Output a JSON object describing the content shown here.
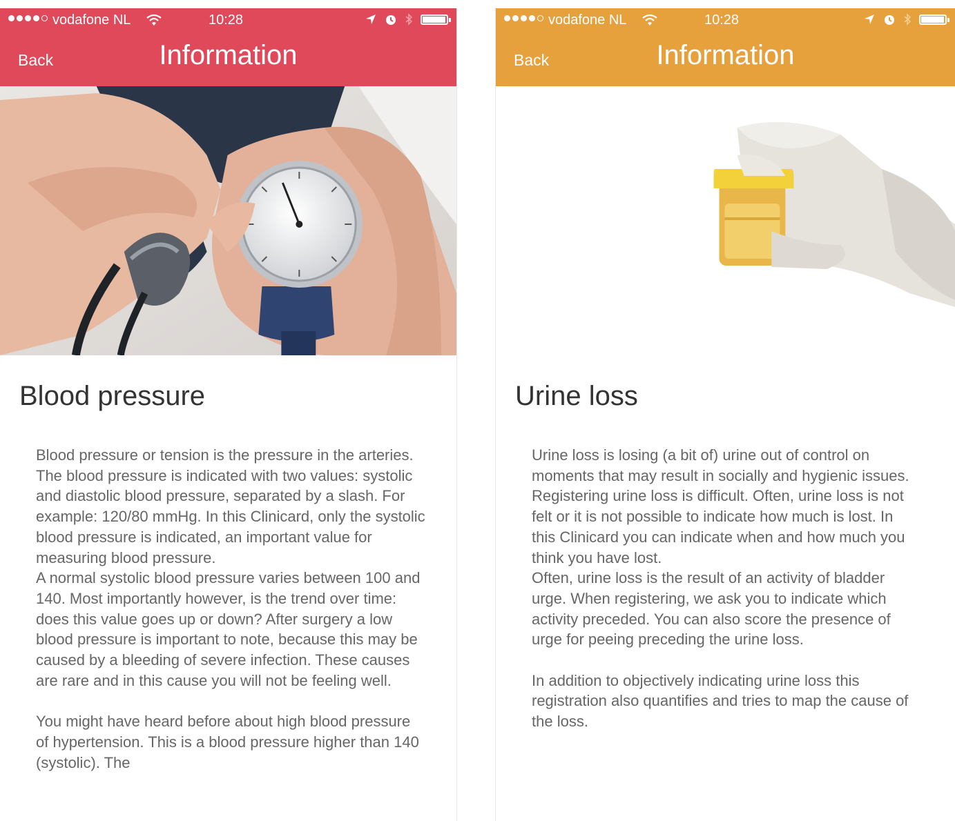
{
  "screens": [
    {
      "status": {
        "carrier": "vodafone NL",
        "time": "10:28"
      },
      "nav": {
        "back_label": "Back",
        "title": "Information",
        "color": "#e0495a"
      },
      "heading": "Blood pressure",
      "paragraphs": [
        "Blood pressure or tension is the pressure in the arteries. The blood pressure is indicated with two values: systolic and diastolic blood pressure, separated by a slash. For example: 120/80 mmHg. In this Clinicard, only the systolic blood pressure is indicated, an important value for measuring blood pressure.",
        "A normal systolic blood pressure varies between 100 and 140. Most importantly however, is the trend over time: does this value goes up or down? After surgery a low blood pressure is important to note, because this may be caused by a bleeding of severe infection. These causes are rare and in this cause you will not be feeling well.",
        "You might have heard before about high blood pressure of hypertension. This is a blood pressure higher than 140 (systolic). The"
      ]
    },
    {
      "status": {
        "carrier": "vodafone NL",
        "time": "10:28"
      },
      "nav": {
        "back_label": "Back",
        "title": "Information",
        "color": "#e6a03c"
      },
      "heading": "Urine loss",
      "paragraphs": [
        "Urine loss is losing (a bit of) urine out of control on moments that may result in socially and hygienic issues. Registering urine loss is difficult. Often, urine loss is not felt or it is not possible to indicate how much is lost. In this Clinicard you can indicate when and how much you think you have lost.",
        "Often, urine loss is the result of an activity of bladder urge. When registering, we ask you to indicate which activity preceded. You can also score the presence of urge for peeing preceding the urine loss.",
        "In addition to objectively indicating urine loss this registration also quantifies and tries to map the cause of the loss."
      ]
    }
  ]
}
